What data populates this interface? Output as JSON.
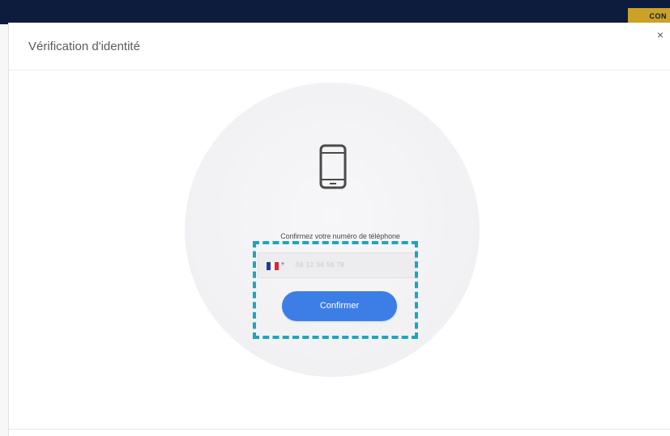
{
  "background": {
    "corner_button_label": "CON"
  },
  "modal": {
    "title": "Vérification d'identité",
    "close_label": "×"
  },
  "verification": {
    "icon": "mobile-phone-icon",
    "prompt": "Confirmez votre numéro de téléphone",
    "phone_input": {
      "country": "fr-flag-icon",
      "value": "06 12 34 56 78"
    },
    "confirm_label": "Confirmer"
  },
  "colors": {
    "primary_button": "#3d7ee6",
    "highlight_border": "#1ea5be",
    "topbar": "#0d1b3d"
  }
}
